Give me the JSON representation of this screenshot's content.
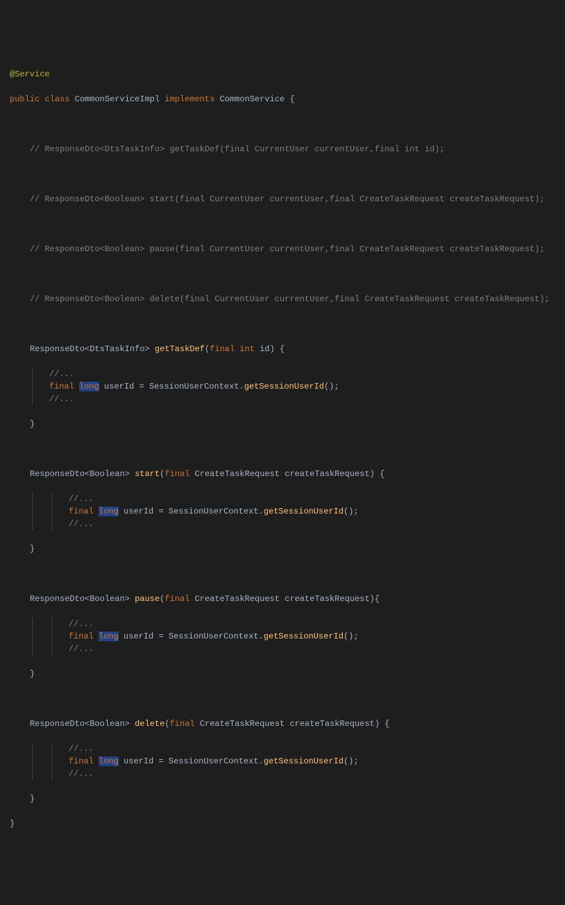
{
  "code": {
    "annotation_at": "@",
    "annotation_name": "Service",
    "kw_public": "public",
    "kw_class": "class",
    "classname": "CommonServiceImpl",
    "kw_implements": "implements",
    "interface": "CommonService",
    "brace_open": "{",
    "brace_close": "}",
    "comment1": "// ResponseDto<DtsTaskInfo> getTaskDef(final CurrentUser currentUser,final int id);",
    "comment2": "// ResponseDto<Boolean> start(final CurrentUser currentUser,final CreateTaskRequest createTaskRequest);",
    "comment3": "// ResponseDto<Boolean> pause(final CurrentUser currentUser,final CreateTaskRequest createTaskRequest);",
    "comment4": "// ResponseDto<Boolean> delete(final CurrentUser currentUser,final CreateTaskRequest createTaskRequest);",
    "type_responsedto": "ResponseDto",
    "lt": "<",
    "gt": ">",
    "type_dtstaskinfo": "DtsTaskInfo",
    "type_boolean": "Boolean",
    "method_gettaskdef": "getTaskDef",
    "method_start": "start",
    "method_pause": "pause",
    "method_delete": "delete",
    "paren_open": "(",
    "paren_close": ")",
    "kw_final": "final",
    "kw_int": "int",
    "kw_long": "long",
    "param_id": "id",
    "param_createtaskrequest": "createTaskRequest",
    "type_createtaskrequest": "CreateTaskRequest",
    "comment_ellipsis": "//...",
    "var_userid": "userId",
    "eq": "=",
    "type_sessionusercontext": "SessionUserContext",
    "dot": ".",
    "method_getsessionuserid": "getSessionUserId",
    "empty_parens": "()",
    "semi": ";",
    "space": " "
  }
}
